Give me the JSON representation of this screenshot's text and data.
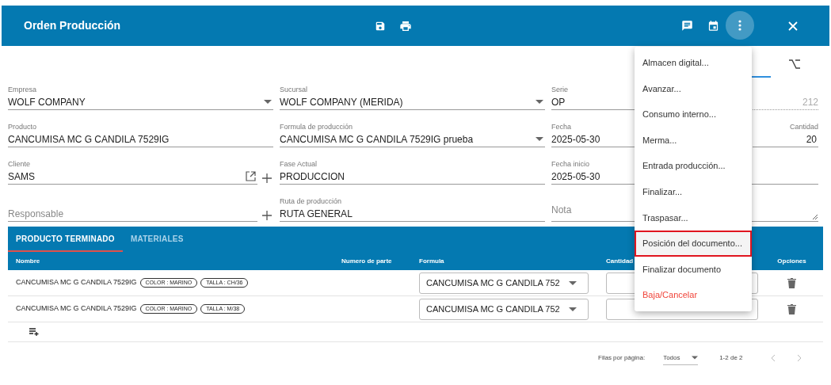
{
  "header": {
    "title": "Orden Producción"
  },
  "form": {
    "rows": [
      [
        [
          {
            "kind": "select",
            "label": "Empresa",
            "value": "WOLF COMPANY"
          }
        ],
        [
          {
            "kind": "select",
            "label": "Sucursal",
            "value": "WOLF COMPANY (MERIDA)"
          }
        ],
        [
          {
            "kind": "text",
            "label": "Serie",
            "value": "OP"
          },
          {
            "kind": "readonly",
            "value": "212"
          }
        ]
      ],
      [
        [
          {
            "kind": "text",
            "label": "Producto",
            "value": "CANCUMISA MC G CANDILA 7529IG"
          }
        ],
        [
          {
            "kind": "select",
            "label": "Formula de producción",
            "value": "CANCUMISA MC G CANDILA 7529IG prueba"
          }
        ],
        [
          {
            "kind": "text",
            "label": "Fecha",
            "value": "2025-05-30"
          },
          {
            "kind": "number",
            "label": "Cantidad",
            "value": "20"
          }
        ]
      ],
      [
        [
          {
            "kind": "lookup",
            "label": "Cliente",
            "value": "SAMS"
          }
        ],
        [
          {
            "kind": "text",
            "label": "Fase Actual",
            "value": "PRODUCCION"
          }
        ],
        [
          {
            "kind": "text",
            "label": "Fecha inicio",
            "value": "2025-05-30"
          }
        ]
      ],
      [
        [
          {
            "kind": "addable",
            "placeholder": "Responsable"
          }
        ],
        [
          {
            "kind": "text",
            "label": "Ruta de producción",
            "value": "RUTA GENERAL"
          }
        ],
        [
          {
            "kind": "textarea",
            "placeholder": "Nota"
          }
        ]
      ]
    ]
  },
  "table": {
    "tabs": [
      {
        "label": "PRODUCTO TERMINADO",
        "selected": true
      },
      {
        "label": "MATERIALES",
        "selected": false
      }
    ],
    "columns": [
      "Nombre",
      "Numero de parte",
      "Formula",
      "Cantidad",
      "Opciones"
    ],
    "rows": [
      {
        "name": "CANCUMISA MC G CANDILA 7529IG",
        "tags": [
          "COLOR : MARINO",
          "TALLA : CH/36"
        ],
        "formula": "CANCUMISA MC G CANDILA 752"
      },
      {
        "name": "CANCUMISA MC G CANDILA 7529IG",
        "tags": [
          "COLOR : MARINO",
          "TALLA : M/38"
        ],
        "formula": "CANCUMISA MC G CANDILA 752"
      }
    ],
    "footer": {
      "rows_per_page_label": "Filas por página:",
      "rows_per_page": "Todos",
      "range": "1-2 de 2"
    }
  },
  "menu": {
    "items": [
      {
        "label": "Almacen digital...",
        "kind": "normal",
        "selected": false
      },
      {
        "label": "Avanzar...",
        "kind": "normal",
        "selected": false
      },
      {
        "label": "Consumo interno...",
        "kind": "normal",
        "selected": false
      },
      {
        "label": "Merma...",
        "kind": "normal",
        "selected": false
      },
      {
        "label": "Entrada producción...",
        "kind": "normal",
        "selected": false
      },
      {
        "label": "Finalizar...",
        "kind": "normal",
        "selected": false
      },
      {
        "label": "Traspasar...",
        "kind": "normal",
        "selected": false
      },
      {
        "label": "Posición del documento...",
        "kind": "normal",
        "selected": true
      },
      {
        "label": "Finalizar documento",
        "kind": "normal",
        "selected": false
      },
      {
        "label": "Baja/Cancelar",
        "kind": "danger",
        "selected": false
      }
    ]
  }
}
